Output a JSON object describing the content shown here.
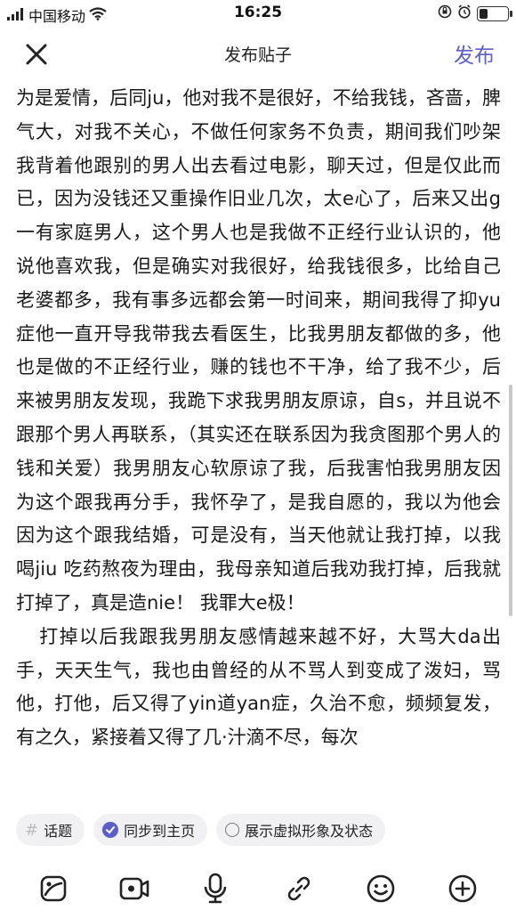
{
  "status_bar": {
    "carrier": "中国移动",
    "time": "16:25"
  },
  "header": {
    "title": "发布贴子",
    "publish_label": "发布"
  },
  "post": {
    "paragraphs": [
      "为是爱情，后同ju，他对我不是很好，不给我钱，吝啬，脾气大，对我不关心，不做任何家务不负责，期间我们吵架我背着他跟别的男人出去看过电影，聊天过，但是仅此而已，因为没钱还又重操作旧业几次，太e心了，后来又出g一有家庭男人，这个男人也是我做不正经行业认识的，他说他喜欢我，但是确实对我很好，给我钱很多，比给自己老婆都多，我有事多远都会第一时间来，期间我得了抑yu症他一直开导我带我去看医生，比我男朋友都做的多，他也是做的不正经行业，赚的钱也不干净，给了我不少，后来被男朋友发现，我跪下求我男朋友原谅，自s，并且说不跟那个男人再联系，（其实还在联系因为我贪图那个男人的钱和关爱）我男朋友心软原谅了我，后我害怕我男朋友因为这个跟我再分手，我怀孕了，是我自愿的，我以为他会因为这个跟我结婚，可是没有，当天他就让我打掉，以我喝jiu 吃药熬夜为理由，我母亲知道后我劝我打掉，后我就打掉了，真是造nie！ 我罪大e极！",
      "打掉以后我跟我男朋友感情越来越不好，大骂大da出手，天天生气，我也由曾经的从不骂人到变成了泼妇，骂他，打他，后又得了yin道yan症，久治不愈，频频复发，有之久，紧接着又得了几·汁滴不尽，每次"
    ]
  },
  "chips": {
    "topic_label": "话题",
    "sync_label": "同步到主页",
    "avatar_label": "展示虚拟形象及状态"
  },
  "toolbar": {
    "icons": [
      "image-icon",
      "video-icon",
      "microphone-icon",
      "link-icon",
      "emoji-icon",
      "add-icon"
    ]
  },
  "colors": {
    "accent": "#5b5fc7",
    "chip_bg": "#f1f1f3",
    "text": "#1a1a1a"
  }
}
